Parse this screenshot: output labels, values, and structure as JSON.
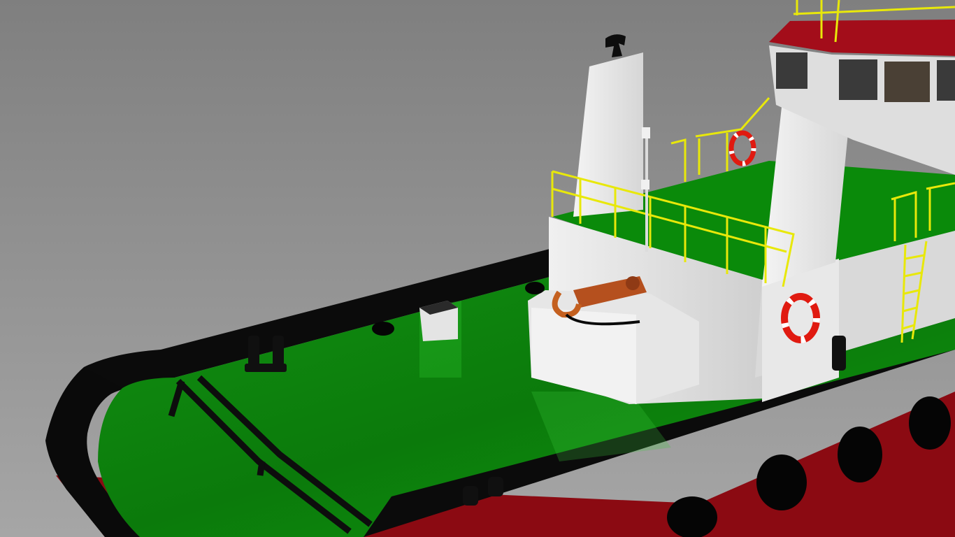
{
  "scene": {
    "subject": "tugboat-render",
    "colors": {
      "background_top": "#7f7f7f",
      "background_bottom": "#a6a6a6",
      "hull_red": "#8b0a12",
      "bulwark_black": "#0a0a0a",
      "deck_green": "#0a8a0a",
      "deck_green_light": "#21b321",
      "superstructure_white": "#e4e4e4",
      "rail_yellow": "#e8e80a",
      "lifebuoy_red": "#e01a10",
      "hook_copper": "#b5501e",
      "wheelhouse_red": "#a30d1a"
    },
    "icons": [
      "lifebuoy-icon",
      "exhaust-stack-icon",
      "towing-hook-icon",
      "bollard-icon"
    ]
  }
}
